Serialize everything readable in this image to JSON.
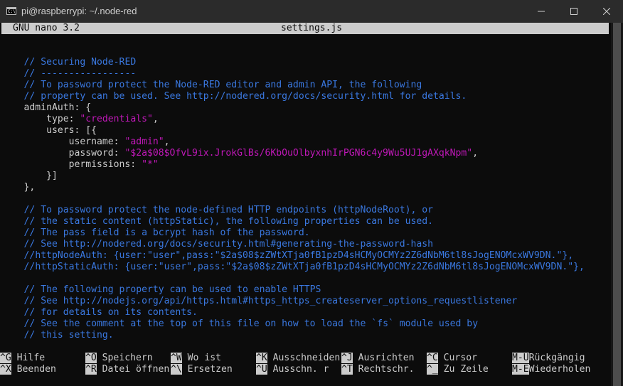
{
  "window": {
    "title": "pi@raspberrypi: ~/.node-red",
    "icon": "console-icon"
  },
  "nano": {
    "version": "GNU nano 3.2",
    "filename": "settings.js"
  },
  "editor": {
    "lines": [
      [],
      [],
      [
        {
          "t": "    "
        },
        {
          "t": "// Securing Node-RED",
          "k": "c"
        }
      ],
      [
        {
          "t": "    "
        },
        {
          "t": "// -----------------",
          "k": "c"
        }
      ],
      [
        {
          "t": "    "
        },
        {
          "t": "// To password protect the Node-RED editor and admin API, the following",
          "k": "c"
        }
      ],
      [
        {
          "t": "    "
        },
        {
          "t": "// property can be used. See http://nodered.org/docs/security.html for details.",
          "k": "c"
        }
      ],
      [
        {
          "t": "    adminAuth: {"
        }
      ],
      [
        {
          "t": "        type: "
        },
        {
          "t": "\"credentials\"",
          "k": "s"
        },
        {
          "t": ","
        }
      ],
      [
        {
          "t": "        users: [{"
        }
      ],
      [
        {
          "t": "            username: "
        },
        {
          "t": "\"admin\"",
          "k": "s"
        },
        {
          "t": ","
        }
      ],
      [
        {
          "t": "            password: "
        },
        {
          "t": "\"$2a$08$OfvL9ix.JrokGlBs/6KbOuOlbyxnhIrPGN6c4y9Wu5UJ1gAXqkNpm\"",
          "k": "s"
        },
        {
          "t": ","
        }
      ],
      [
        {
          "t": "            permissions: "
        },
        {
          "t": "\"*\"",
          "k": "s"
        }
      ],
      [
        {
          "t": "        }]"
        }
      ],
      [
        {
          "t": "    },"
        }
      ],
      [],
      [
        {
          "t": "    "
        },
        {
          "t": "// To password protect the node-defined HTTP endpoints (httpNodeRoot), or",
          "k": "c"
        }
      ],
      [
        {
          "t": "    "
        },
        {
          "t": "// the static content (httpStatic), the following properties can be used.",
          "k": "c"
        }
      ],
      [
        {
          "t": "    "
        },
        {
          "t": "// The pass field is a bcrypt hash of the password.",
          "k": "c"
        }
      ],
      [
        {
          "t": "    "
        },
        {
          "t": "// See http://nodered.org/docs/security.html#generating-the-password-hash",
          "k": "c"
        }
      ],
      [
        {
          "t": "    "
        },
        {
          "t": "//httpNodeAuth: {user:\"user\",pass:\"$2a$08$zZWtXTja0fB1pzD4sHCMyOCMYz2Z6dNbM6tl8sJogENOMcxWV9DN.\"},",
          "k": "c"
        }
      ],
      [
        {
          "t": "    "
        },
        {
          "t": "//httpStaticAuth: {user:\"user\",pass:\"$2a$08$zZWtXTja0fB1pzD4sHCMyOCMYz2Z6dNbM6tl8sJogENOMcxWV9DN.\"},",
          "k": "c"
        }
      ],
      [],
      [
        {
          "t": "    "
        },
        {
          "t": "// The following property can be used to enable HTTPS",
          "k": "c"
        }
      ],
      [
        {
          "t": "    "
        },
        {
          "t": "// See http://nodejs.org/api/https.html#https_https_createserver_options_requestlistener",
          "k": "c"
        }
      ],
      [
        {
          "t": "    "
        },
        {
          "t": "// for details on its contents.",
          "k": "c"
        }
      ],
      [
        {
          "t": "    "
        },
        {
          "t": "// See the comment at the top of this file on how to load the `fs` module used by",
          "k": "c"
        }
      ],
      [
        {
          "t": "    "
        },
        {
          "t": "// this setting.",
          "k": "c"
        }
      ]
    ]
  },
  "shortcuts": [
    {
      "key": "^G",
      "label": "Hilfe"
    },
    {
      "key": "^X",
      "label": "Beenden"
    },
    {
      "key": "^O",
      "label": "Speichern"
    },
    {
      "key": "^R",
      "label": "Datei öffnen"
    },
    {
      "key": "^W",
      "label": "Wo ist"
    },
    {
      "key": "^\\",
      "label": "Ersetzen"
    },
    {
      "key": "^K",
      "label": "Ausschneiden"
    },
    {
      "key": "^U",
      "label": "Ausschn. r"
    },
    {
      "key": "^J",
      "label": "Ausrichten"
    },
    {
      "key": "^T",
      "label": "Rechtschr."
    },
    {
      "key": "^C",
      "label": "Cursor"
    },
    {
      "key": "^_",
      "label": "Zu Zeile"
    },
    {
      "key": "M-U",
      "label": "Rückgängig"
    },
    {
      "key": "M-E",
      "label": "Wiederholen"
    }
  ],
  "colors": {
    "terminal_bg": "#0c0c0c",
    "text": "#cccccc",
    "comment": "#3a78e0",
    "string": "#c018b8",
    "titlebar": "#2b2b2b"
  }
}
